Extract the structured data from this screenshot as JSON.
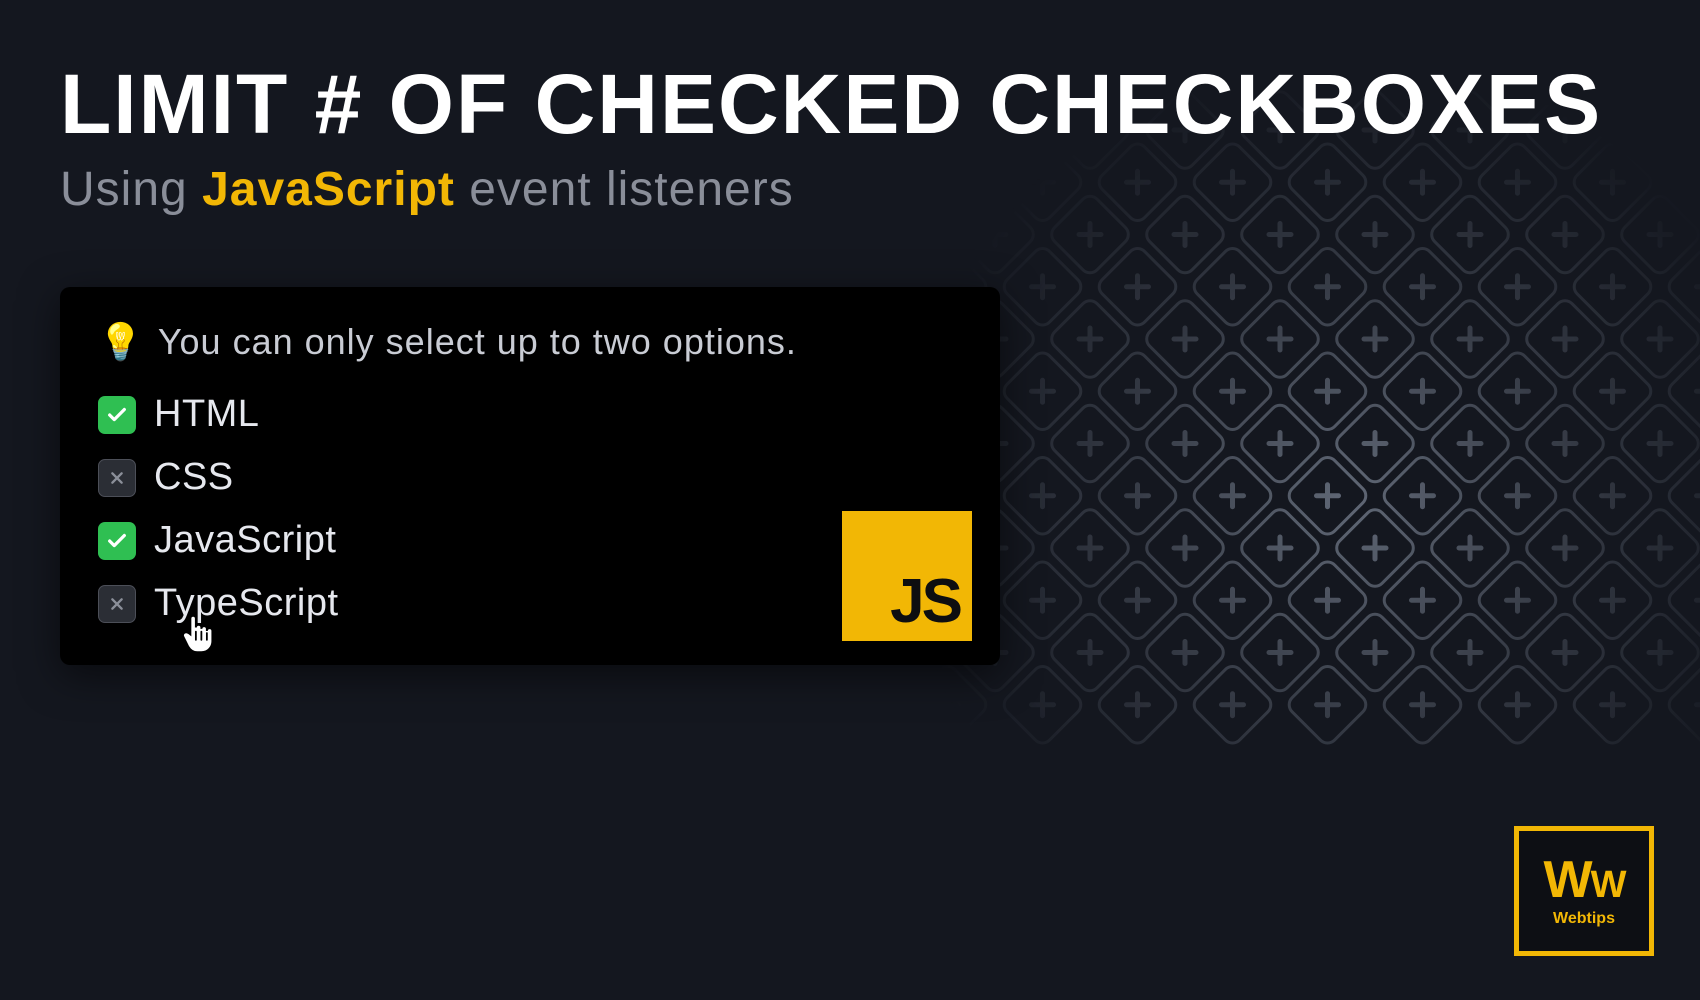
{
  "title": "LIMIT # OF CHECKED CHECKBOXES",
  "subtitle_pre": "Using ",
  "subtitle_hl": "JavaScript",
  "subtitle_post": " event listeners",
  "hint": "You can only select up to two options.",
  "options": [
    {
      "label": "HTML",
      "state": "checked"
    },
    {
      "label": "CSS",
      "state": "disabled"
    },
    {
      "label": "JavaScript",
      "state": "checked"
    },
    {
      "label": "TypeScript",
      "state": "disabled"
    }
  ],
  "badge": "JS",
  "brand": {
    "mark": "WW",
    "name": "Webtips"
  }
}
